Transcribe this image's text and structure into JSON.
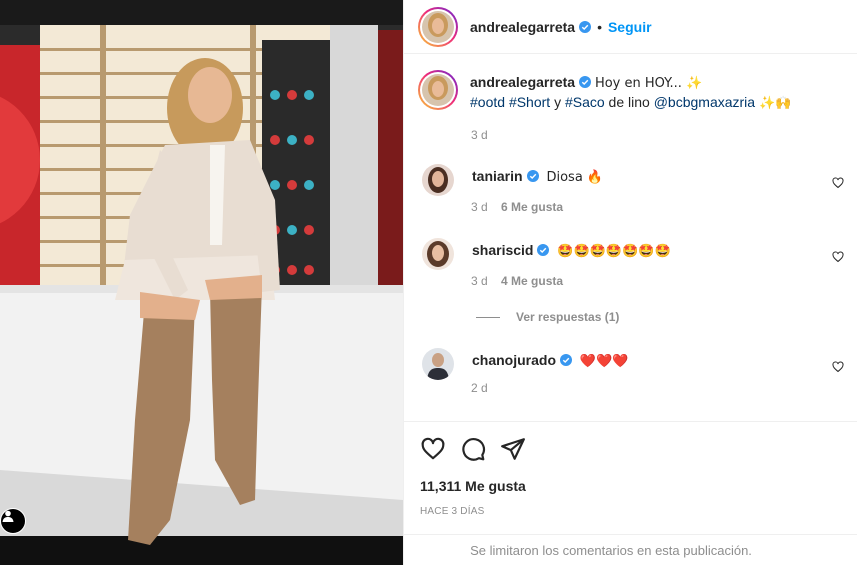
{
  "post": {
    "author": "andrealegarreta",
    "follow_label": "Seguir",
    "dot": "•"
  },
  "caption": {
    "username": "andrealegarreta",
    "line1": "Hoy en HOY... ✨",
    "hashtag1": "#ootd",
    "hashtag2": "#Short",
    "middle": " y ",
    "hashtag3": "#Saco",
    "tail": " de lino ",
    "mention": "@bcbgmaxazria",
    "end_emoji": " ✨🙌",
    "time": "3 d"
  },
  "comments": [
    {
      "username": "taniarin",
      "text": "Diosa 🔥",
      "time": "3 d",
      "likes": "6 Me gusta"
    },
    {
      "username": "shariscid",
      "text": "🤩🤩🤩🤩🤩🤩🤩",
      "time": "3 d",
      "likes": "4 Me gusta",
      "replies": "Ver respuestas (1)"
    },
    {
      "username": "chanojurado",
      "text": "❤️❤️❤️",
      "time": "2 d",
      "likes": ""
    }
  ],
  "actions": {
    "like_icon": "heart-icon",
    "comment_icon": "comment-icon",
    "share_icon": "paper-plane-icon"
  },
  "likes_count": "11,311 Me gusta",
  "posted": "HACE 3 DÍAS",
  "comments_limited": "Se limitaron los comentarios en esta publicación.",
  "colors": {
    "link": "#0095f6",
    "hashtag": "#00376b",
    "muted": "#8e8e8e",
    "verified": "#3897f0"
  }
}
